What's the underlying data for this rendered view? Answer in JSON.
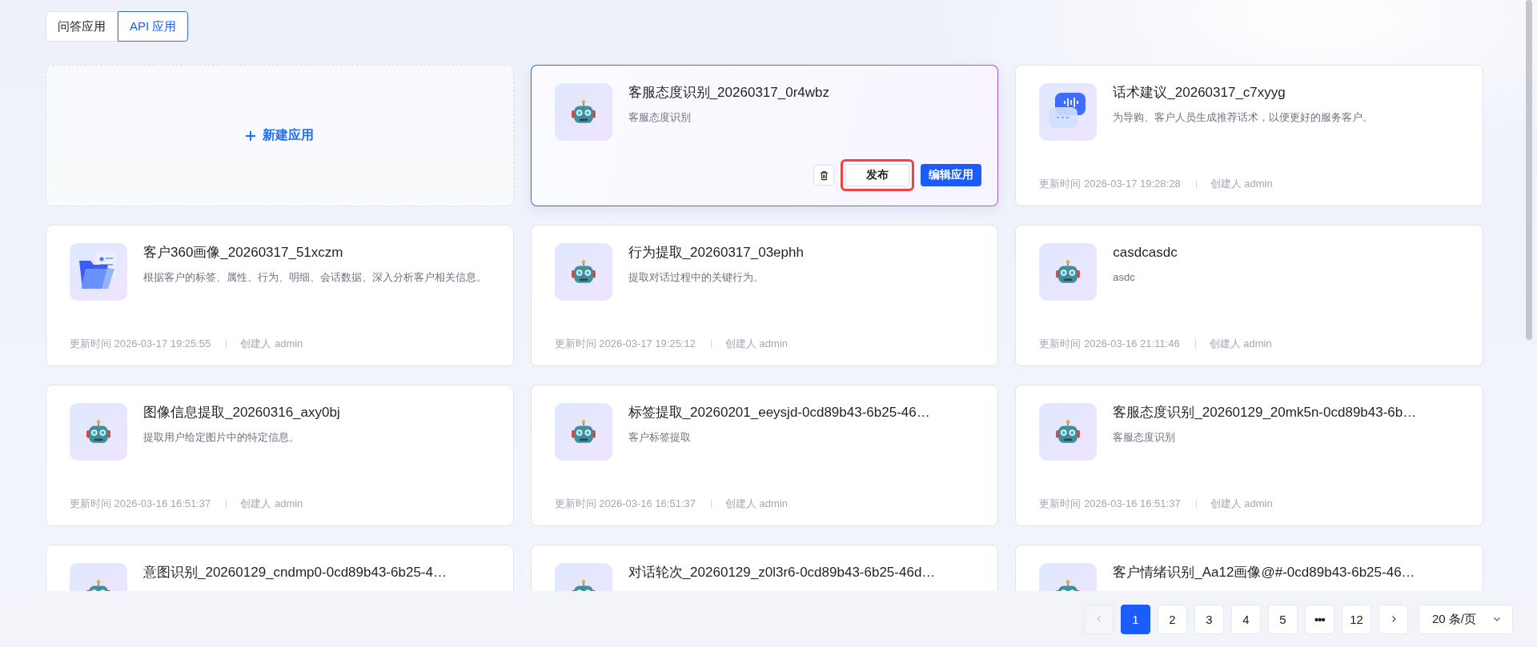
{
  "tabs": [
    {
      "label": "问答应用",
      "selected": false
    },
    {
      "label": "API 应用",
      "selected": true
    }
  ],
  "new_app": {
    "label": "新建应用"
  },
  "cards": [
    {
      "title": "客服态度识别_20260317_0r4wbz",
      "description": "客服态度识别",
      "kind": "robot",
      "hovered": true,
      "actions": {
        "publish": "发布",
        "edit": "编辑应用",
        "publish_highlighted": true
      }
    },
    {
      "title": "话术建议_20260317_c7xyyg",
      "description": "为导购、客户人员生成推荐话术，以便更好的服务客户。",
      "kind": "chat",
      "hovered": false,
      "updated": "更新时间 2026-03-17 19:28:28",
      "creator": "创建人 admin"
    },
    {
      "title": "客户360画像_20260317_51xczm",
      "description": "根据客户的标签、属性、行为、明细、会话数据、深入分析客户相关信息。",
      "kind": "folder",
      "hovered": false,
      "updated": "更新时间 2026-03-17 19:25:55",
      "creator": "创建人 admin"
    },
    {
      "title": "行为提取_20260317_03ephh",
      "description": "提取对话过程中的关键行为。",
      "kind": "robot",
      "hovered": false,
      "updated": "更新时间 2026-03-17 19:25:12",
      "creator": "创建人 admin"
    },
    {
      "title": "casdcasdc",
      "description": "asdc",
      "kind": "robot",
      "hovered": false,
      "updated": "更新时间 2026-03-16 21:11:46",
      "creator": "创建人 admin"
    },
    {
      "title": "图像信息提取_20260316_axy0bj",
      "description": "提取用户给定图片中的特定信息。",
      "kind": "robot",
      "hovered": false,
      "updated": "更新时间 2026-03-16 16:51:37",
      "creator": "创建人 admin"
    },
    {
      "title": "标签提取_20260201_eeysjd-0cd89b43-6b25-46…",
      "description": "客户标签提取",
      "kind": "robot",
      "hovered": false,
      "updated": "更新时间 2026-03-16 16:51:37",
      "creator": "创建人 admin"
    },
    {
      "title": "客服态度识别_20260129_20mk5n-0cd89b43-6b…",
      "description": "客服态度识别",
      "kind": "robot",
      "hovered": false,
      "updated": "更新时间 2026-03-16 16:51:37",
      "creator": "创建人 admin"
    },
    {
      "title": "意图识别_20260129_cndmp0-0cd89b43-6b25-4…",
      "kind": "robot",
      "hovered": false
    },
    {
      "title": "对话轮次_20260129_z0l3r6-0cd89b43-6b25-46d…",
      "kind": "robot",
      "hovered": false
    },
    {
      "title": "客户情绪识别_Aa12画像@#-0cd89b43-6b25-46…",
      "kind": "robot",
      "hovered": false
    }
  ],
  "pagination": {
    "prev_disabled": true,
    "next_disabled": false,
    "pages": [
      {
        "label": "1",
        "kind": "page",
        "selected": true
      },
      {
        "label": "2",
        "kind": "page",
        "selected": false
      },
      {
        "label": "3",
        "kind": "page",
        "selected": false
      },
      {
        "label": "4",
        "kind": "page",
        "selected": false
      },
      {
        "label": "5",
        "kind": "page",
        "selected": false
      },
      {
        "label": "•••",
        "kind": "ellipsis",
        "selected": false
      },
      {
        "label": "12",
        "kind": "page",
        "selected": false
      }
    ],
    "page_size": "20 条/页"
  }
}
